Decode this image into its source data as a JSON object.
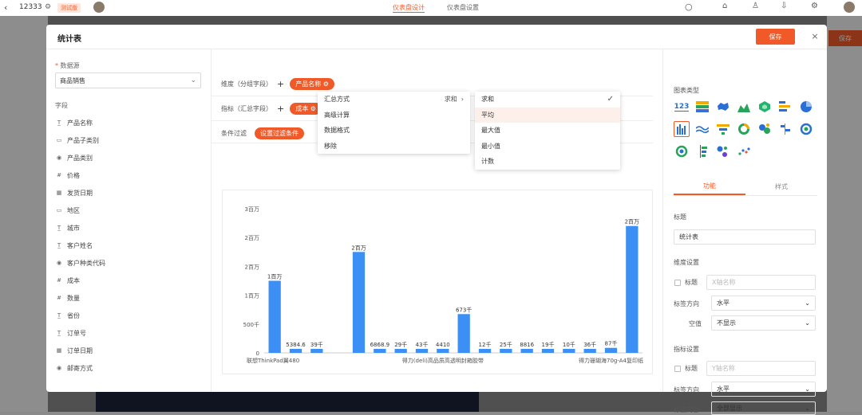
{
  "topbar": {
    "app_id": "12333",
    "env_badge": "测试版",
    "tabs": [
      "仪表盘设计",
      "仪表盘设置"
    ]
  },
  "background_save": "保存",
  "modal": {
    "title": "统计表",
    "save_label": "保存",
    "close_label": "×"
  },
  "left": {
    "datasource_label": "数据源",
    "datasource_value": "商品销售",
    "fields_label": "字段",
    "fields": [
      {
        "label": "产品名称",
        "icon": "T"
      },
      {
        "label": "产品子类别",
        "icon": "tag"
      },
      {
        "label": "产品类别",
        "icon": "radio"
      },
      {
        "label": "价格",
        "icon": "num"
      },
      {
        "label": "发货日期",
        "icon": "date"
      },
      {
        "label": "地区",
        "icon": "tag"
      },
      {
        "label": "城市",
        "icon": "T"
      },
      {
        "label": "客户姓名",
        "icon": "T"
      },
      {
        "label": "客户种类代码",
        "icon": "radio"
      },
      {
        "label": "成本",
        "icon": "num"
      },
      {
        "label": "数量",
        "icon": "num"
      },
      {
        "label": "省份",
        "icon": "T"
      },
      {
        "label": "订单号",
        "icon": "T"
      },
      {
        "label": "订单日期",
        "icon": "date"
      },
      {
        "label": "邮寄方式",
        "icon": "radio"
      }
    ]
  },
  "center": {
    "dimension_label": "维度（分组字段）",
    "dimension_pill": "产品名称",
    "metric_label": "指标（汇总字段）",
    "metric_pill": "成本",
    "filter_label": "条件过滤",
    "filter_pill": "设置过滤条件"
  },
  "context_menu": {
    "items": [
      "汇总方式",
      "高级计算",
      "数据格式",
      "移除"
    ],
    "agg_current": "求和"
  },
  "submenu": {
    "items": [
      "求和",
      "平均",
      "最大值",
      "最小值",
      "计数"
    ],
    "checked_index": 0,
    "hovered_index": 1
  },
  "chart_data": {
    "type": "bar",
    "color": "#3b8ff5",
    "y_ticks": [
      "0",
      "500千",
      "1百万",
      "2百万",
      "2百万",
      "3百万"
    ],
    "ylim": [
      0,
      2500000
    ],
    "x_labels": [
      {
        "label": "联想ThinkPad翼480",
        "index": 0
      },
      {
        "label": "得力(deli)高品质高透明封箱胶带",
        "index": 8
      },
      {
        "label": "得力珊瑚海70g-A4复印纸",
        "index": 16
      }
    ],
    "values": [
      1250000,
      5384.6,
      39000,
      0,
      1750000,
      6868.9,
      29000,
      43000,
      4410,
      673000,
      12000,
      25000,
      8816,
      19000,
      10000,
      36000,
      87000,
      2200000
    ],
    "data_labels": [
      "1百万",
      "5384.6",
      "39千",
      "",
      "2百万",
      "6868.9",
      "29千",
      "43千",
      "4410",
      "673千",
      "12千",
      "25千",
      "8816",
      "19千",
      "10千",
      "36千",
      "87千",
      "2百万"
    ]
  },
  "right": {
    "chart_type_label": "图表类型",
    "tabs": [
      "功能",
      "样式"
    ],
    "title_label": "标题",
    "title_value": "统计表",
    "dim_settings_label": "维度设置",
    "dim_title_label": "标题",
    "dim_title_placeholder": "X轴名称",
    "label_dir_label": "标签方向",
    "label_dir_value": "水平",
    "empty_label": "空值",
    "empty_value": "不显示",
    "metric_settings_label": "指标设置",
    "metric_title_label": "标题",
    "metric_title_placeholder": "Y轴名称",
    "metric_dir_label": "标签方向",
    "metric_dir_value": "水平",
    "label_content_label": "标签内容",
    "label_content_value": "全部显示"
  }
}
